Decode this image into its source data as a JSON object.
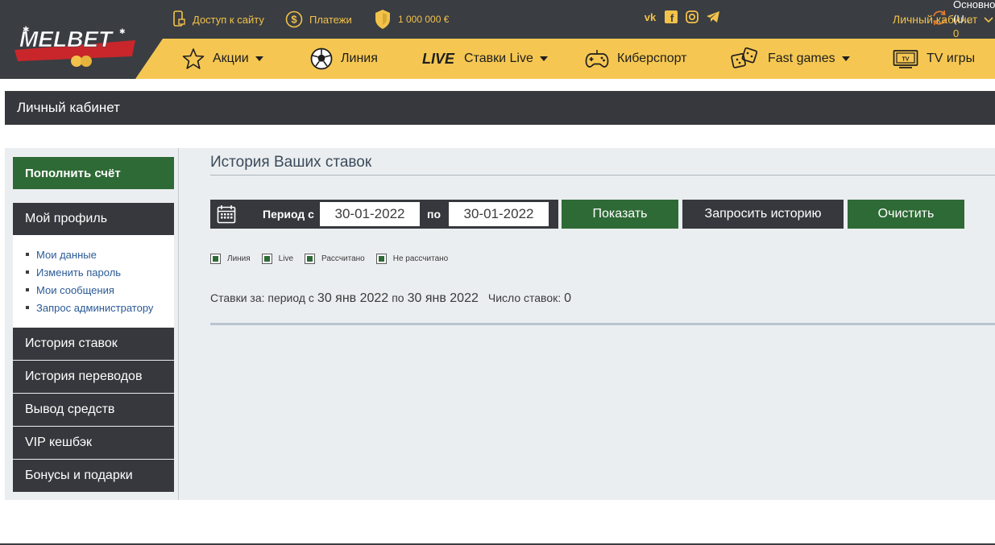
{
  "brand": {
    "logo_text": "MELBET"
  },
  "topbar": {
    "site_access": "Доступ к сайту",
    "payments": "Платежи",
    "bonus": "1 000 000 €",
    "social": [
      "vk-icon",
      "facebook-icon",
      "instagram-icon",
      "telegram-icon"
    ],
    "account_name": "Основной (U...",
    "account_balance": "0",
    "cabinet": "Личный кабинет"
  },
  "nav": {
    "items": [
      {
        "label": "Акции",
        "icon": "star-icon",
        "dropdown": true
      },
      {
        "label": "Линия",
        "icon": "soccer-ball-icon",
        "dropdown": false
      },
      {
        "prefix": "LIVE",
        "label": "Ставки Live",
        "icon": "",
        "dropdown": true
      },
      {
        "label": "Киберспорт",
        "icon": "gamepad-icon",
        "dropdown": false
      },
      {
        "label": "Fast games",
        "icon": "dice-icon",
        "dropdown": true
      },
      {
        "label": "TV игры",
        "icon": "tv-icon",
        "dropdown": false
      }
    ]
  },
  "page": {
    "title": "Личный кабинет"
  },
  "sidebar": {
    "deposit": "Пополнить счёт",
    "profile": "Мой профиль",
    "profile_items": [
      "Мои данные",
      "Изменить пароль",
      "Мои сообщения",
      "Запрос администратору"
    ],
    "sections": [
      "История ставок",
      "История переводов",
      "Вывод средств",
      "VIP кешбэк",
      "Бонусы и подарки"
    ]
  },
  "main": {
    "title": "История Ваших ставок",
    "filter": {
      "from_label": "Период с",
      "from_value": "30-01-2022",
      "to_label": "по",
      "to_value": "30-01-2022",
      "show_button": "Показать",
      "request_button": "Запросить историю",
      "clear_button": "Очистить"
    },
    "checkboxes": [
      {
        "label": "Линия",
        "checked": true
      },
      {
        "label": "Live",
        "checked": true
      },
      {
        "label": "Рассчитано",
        "checked": true
      },
      {
        "label": "Не рассчитано",
        "checked": true
      }
    ],
    "summary": {
      "prefix": "Ставки за: период с",
      "date_from": "30 янв 2022",
      "middle": "по",
      "date_to": "30 янв 2022",
      "count_label": "Число ставок:",
      "count": "0"
    }
  },
  "colors": {
    "header_bg": "#3a3d42",
    "accent_yellow": "#f5c752",
    "green": "#2e6a35",
    "dark_panel": "#36383d",
    "content_bg": "#ebeef0",
    "link_blue": "#2a5a96"
  }
}
